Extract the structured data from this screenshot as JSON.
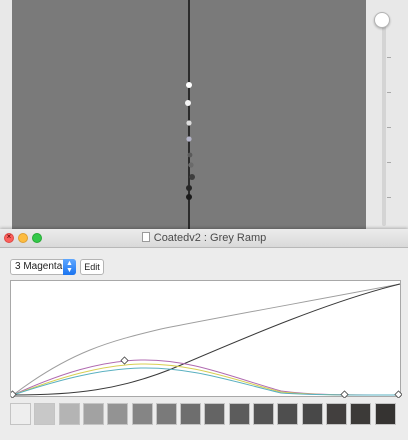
{
  "window": {
    "title": "Coatedv2 : Grey Ramp"
  },
  "toolbar": {
    "channel_value": "3 Magenta",
    "edit_label": "Edit"
  },
  "icons": {
    "document": "document-icon",
    "stepper": "up-down-chevron-icon",
    "close": "close-icon",
    "minimize": "minimize-icon",
    "maximize": "maximize-icon"
  },
  "colors": {
    "plot_background": "#7a7a7a",
    "curve_grey": "#9e9e9e",
    "curve_black": "#3a3a3a",
    "curve_magenta": "#b06ab0",
    "curve_yellow": "#d8cf52",
    "curve_cyan": "#5ab0c0",
    "select_accent": "#1b74f0",
    "close_button": "#fc605c",
    "minimize_button": "#fdbc40",
    "maximize_button": "#34c84a"
  },
  "swatch_colors": [
    "#eeeeee",
    "#c8c8c8",
    "#b4b4b4",
    "#a2a2a2",
    "#939393",
    "#858585",
    "#7a7a7a",
    "#6e6e6e",
    "#646464",
    "#5c5c5c",
    "#545454",
    "#4e4e4e",
    "#484848",
    "#423f3e",
    "#3c3a38",
    "#353331"
  ],
  "slider": {
    "level": 1.0
  }
}
